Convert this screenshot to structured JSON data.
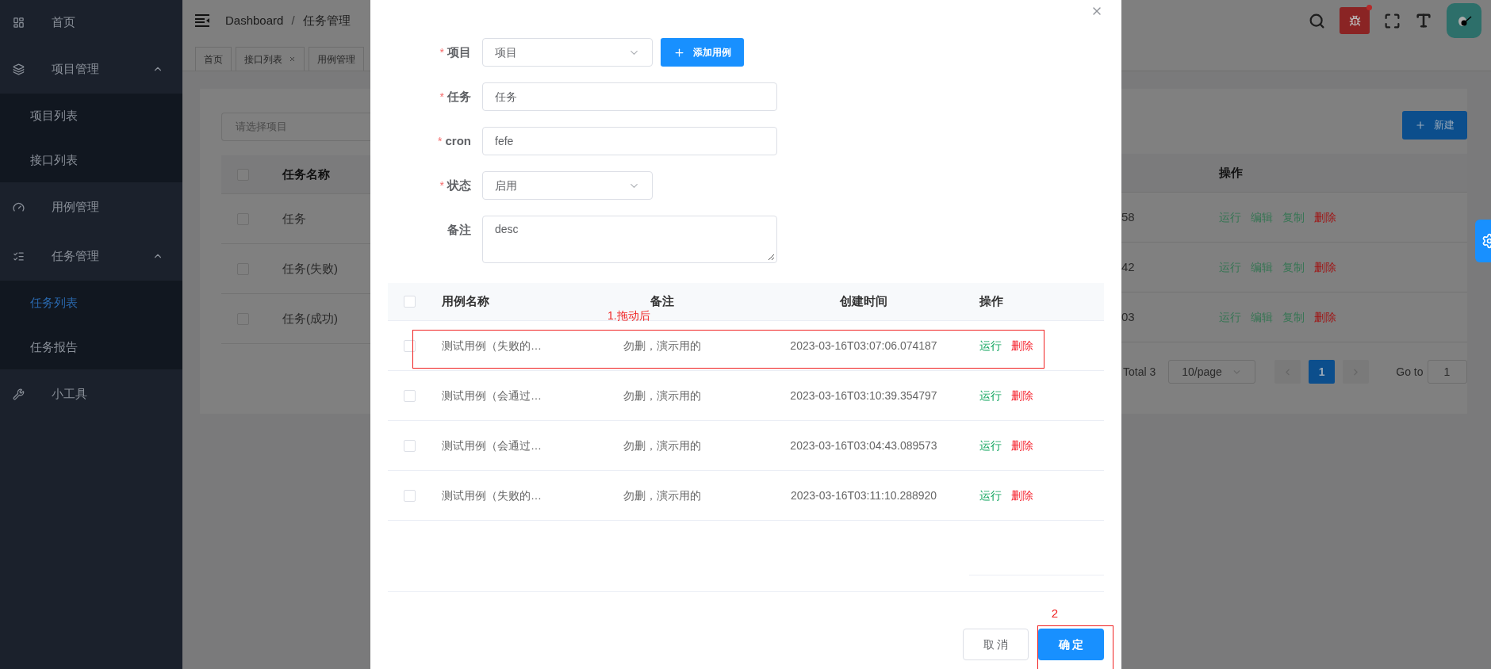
{
  "sidebar": {
    "items": [
      {
        "label": "首页"
      },
      {
        "label": "项目管理",
        "expanded": true,
        "children": [
          {
            "label": "项目列表",
            "selected": false
          },
          {
            "label": "接口列表",
            "selected": false
          }
        ]
      },
      {
        "label": "用例管理"
      },
      {
        "label": "任务管理",
        "expanded": true,
        "children": [
          {
            "label": "任务列表",
            "selected": true
          },
          {
            "label": "任务报告",
            "selected": false
          }
        ]
      },
      {
        "label": "小工具"
      }
    ]
  },
  "header": {
    "breadcrumb": [
      "Dashboard",
      "任务管理"
    ],
    "separator": "/"
  },
  "tags": [
    {
      "label": "首页",
      "closable": false
    },
    {
      "label": "接口列表",
      "closable": true
    },
    {
      "label": "用例管理",
      "closable": false
    }
  ],
  "page": {
    "search_placeholder": "请选择项目",
    "new_button": "新建",
    "table": {
      "columns": [
        "任务名称",
        "操作"
      ],
      "all_checked": false,
      "rows": [
        {
          "name": "任务",
          "column_3": "58",
          "checked": false,
          "actions": [
            {
              "label": "运行",
              "kind": "normal"
            },
            {
              "label": "编辑",
              "kind": "normal"
            },
            {
              "label": "复制",
              "kind": "normal"
            },
            {
              "label": "删除",
              "kind": "danger"
            }
          ]
        },
        {
          "name": "任务(失败)",
          "column_3": "42",
          "checked": false,
          "actions": [
            {
              "label": "运行",
              "kind": "normal"
            },
            {
              "label": "编辑",
              "kind": "normal"
            },
            {
              "label": "复制",
              "kind": "normal"
            },
            {
              "label": "删除",
              "kind": "danger"
            }
          ]
        },
        {
          "name": "任务(成功)",
          "column_3": "03",
          "checked": false,
          "actions": [
            {
              "label": "运行",
              "kind": "normal"
            },
            {
              "label": "编辑",
              "kind": "normal"
            },
            {
              "label": "复制",
              "kind": "normal"
            },
            {
              "label": "删除",
              "kind": "danger"
            }
          ]
        }
      ]
    },
    "pagination": {
      "total": "Total 3",
      "page_size": "10/page",
      "pages": [
        {
          "label": "1",
          "selected": true
        }
      ],
      "goto_label": "Go to",
      "goto_value": "1"
    }
  },
  "modal": {
    "fields": [
      {
        "label": "项目",
        "required_mark": "*",
        "kind": "select",
        "value": "项目"
      },
      {
        "label": "任务",
        "required_mark": "*",
        "kind": "input",
        "value": "任务"
      },
      {
        "label": "cron",
        "required_mark": "*",
        "kind": "input",
        "value": "fefe"
      },
      {
        "label": "状态",
        "required_mark": "*",
        "kind": "select",
        "value": "启用"
      },
      {
        "label": "备注",
        "kind": "textarea",
        "value": "desc"
      }
    ],
    "add_button": "添加用例",
    "table": {
      "columns": [
        "用例名称",
        "备注",
        "创建时间",
        "操作"
      ],
      "all_checked": false,
      "rows": [
        {
          "name": "测试用例（失败的…",
          "note": "勿删，演示用的",
          "created": "2023-03-16T03:07:06.074187",
          "checked": false,
          "actions": [
            {
              "label": "运行",
              "kind": "normal"
            },
            {
              "label": "删除",
              "kind": "danger"
            }
          ]
        },
        {
          "name": "测试用例（会通过…",
          "note": "勿删，演示用的",
          "created": "2023-03-16T03:10:39.354797",
          "checked": false,
          "actions": [
            {
              "label": "运行",
              "kind": "normal"
            },
            {
              "label": "删除",
              "kind": "danger"
            }
          ]
        },
        {
          "name": "测试用例（会通过…",
          "note": "勿删，演示用的",
          "created": "2023-03-16T03:04:43.089573",
          "checked": false,
          "actions": [
            {
              "label": "运行",
              "kind": "normal"
            },
            {
              "label": "删除",
              "kind": "danger"
            }
          ]
        },
        {
          "name": "测试用例（失败的…",
          "note": "勿删，演示用的",
          "created": "2023-03-16T03:11:10.288920",
          "checked": false,
          "actions": [
            {
              "label": "运行",
              "kind": "normal"
            },
            {
              "label": "删除",
              "kind": "danger"
            }
          ]
        }
      ]
    },
    "cancel_button": "取 消",
    "ok_button": "确 定"
  },
  "annotations": [
    {
      "text": "1.拖动后",
      "kind": "row"
    },
    {
      "text": "2",
      "kind": "ok"
    }
  ]
}
